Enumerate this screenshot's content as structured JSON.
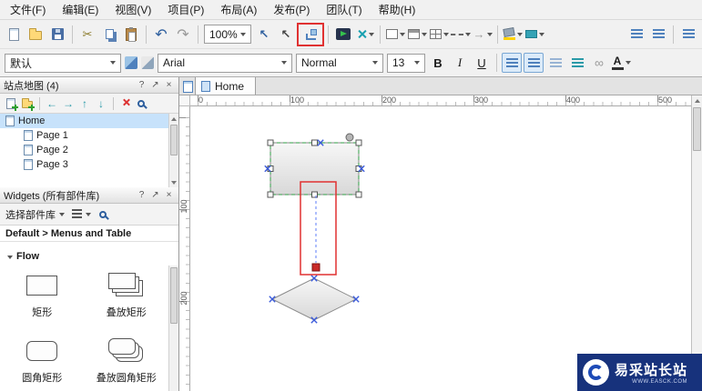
{
  "menubar": {
    "items": [
      "文件(F)",
      "编辑(E)",
      "视图(V)",
      "项目(P)",
      "布局(A)",
      "发布(P)",
      "团队(T)",
      "帮助(H)"
    ]
  },
  "toolbar1": {
    "zoom_value": "100%"
  },
  "toolbar2": {
    "style_value": "默认",
    "font_value": "Arial",
    "font_weight_value": "Normal",
    "font_size_value": "13",
    "bold_label": "B",
    "italic_label": "I",
    "underline_label": "U",
    "font_color_label": "A"
  },
  "glyphs": {
    "cut": "✂",
    "undo": "↶",
    "redo": "↷",
    "pointer": "↖",
    "arrow_up": "↑",
    "arrow_down": "↓",
    "arrow_left": "←",
    "arrow_right": "→",
    "help": "?",
    "popout": "↗",
    "close": "×",
    "link": "∞"
  },
  "sitemap": {
    "title": "站点地图 (4)",
    "pages": [
      {
        "label": "Home"
      },
      {
        "label": "Page 1"
      },
      {
        "label": "Page 2"
      },
      {
        "label": "Page 3"
      }
    ]
  },
  "widgets": {
    "title": "Widgets (所有部件库)",
    "library_select_label": "选择部件库",
    "breadcrumb": "Default > Menus and Table",
    "section_label": "Flow",
    "items": [
      {
        "label": "矩形"
      },
      {
        "label": "叠放矩形"
      },
      {
        "label": "圆角矩形"
      },
      {
        "label": "叠放圆角矩形"
      }
    ]
  },
  "canvas": {
    "tab_label": "Home",
    "hruler_labels": [
      "0",
      "100",
      "200",
      "300",
      "400",
      "500"
    ],
    "vruler_labels": [
      "100",
      "200"
    ]
  },
  "watermark": {
    "title": "易采站长站",
    "subtitle": "WWW.EASCK.COM"
  }
}
